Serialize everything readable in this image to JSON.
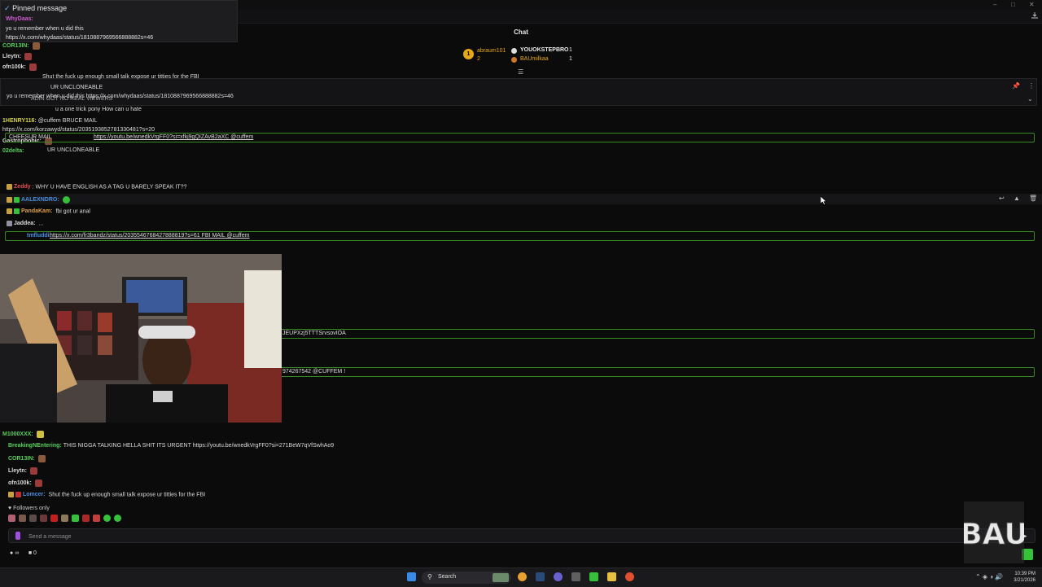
{
  "pinned": {
    "header": "Pinned message",
    "user": "WhyDaas:",
    "line1": "yo u remember when u did this",
    "line2": "https://x.com/whydaas/status/1810887969566888882s=46"
  },
  "chat_title": "Chat",
  "leaderboard": {
    "first_name": "abraum101",
    "first_count": "2",
    "second_name": "YOUOKSTEPBRO",
    "second_count": "1",
    "third_name": "BAUmilkaa",
    "third_count": "1"
  },
  "lines": [
    {
      "user": "COR13IN:",
      "text": "",
      "color": "#56d05a"
    },
    {
      "user": "Lleytn:",
      "text": "",
      "color": "#dcdcdc"
    },
    {
      "user": "ofn100k:",
      "text": "",
      "color": "#dcdcdc"
    },
    {
      "user": "",
      "text": "Shut the fuck up enough small talk expose ur titties for the FBI",
      "color": "#dcdcdc"
    },
    {
      "user": "",
      "text": "UR UNCLONEABLE",
      "color": "#dcdcdc"
    },
    {
      "user": "",
      "text": "yo u remember when u did this https://x.com/whydaas/status/1810887969566888882s=46",
      "color": "#dcdcdc"
    },
    {
      "user": "",
      "text": "ADIN GOT NO REAL VIEWERS",
      "color": "#dcdcdc"
    },
    {
      "user": "",
      "text": "u a one trick pony How can u hate",
      "color": "#dcdcdc"
    },
    {
      "user": "1HENRY116:",
      "text": "@cuffem BRUCE MAIL",
      "color": "#d6d24a"
    },
    {
      "user": "",
      "text": "https://x.com/korzawyd/status/2035193852781330481?s=20",
      "color": "#dcdcdc"
    },
    {
      "user": "Gastrophobic:",
      "text": "",
      "color": "#dcdcdc"
    },
    {
      "user": "02delta:",
      "text": "",
      "color": "#56d05a"
    },
    {
      "user": "",
      "text": "UR UNCLONEABLE",
      "color": "#dcdcdc"
    },
    {
      "user": "Zeddy",
      "text": "WHY U HAVE ENGLISH AS A TAG U BARELY SPEAK IT??",
      "color": "#e05050"
    },
    {
      "user": "AALEXNDRO:",
      "text": "",
      "color": "#4a8fe0"
    },
    {
      "user": "PandaKam:",
      "text": "fbi got ur anal",
      "color": "#e0a04a"
    },
    {
      "user": "Jaddea:",
      "text": "...",
      "color": "#dcdcdc"
    },
    {
      "user": "M1000XXX:",
      "text": "",
      "color": "#56d05a"
    },
    {
      "user": "BreakingNEntering:",
      "text": "THIS NIGGA TALKING HELLA SHIT ITS URGENT https://youtu.be/wnedkVrgFF0?si=271BeW7qVfSwhAo9",
      "color": "#56d05a"
    },
    {
      "user": "COR13IN:",
      "text": "",
      "color": "#56d05a"
    },
    {
      "user": "Lleytn:",
      "text": "",
      "color": "#dcdcdc"
    },
    {
      "user": "ofn100k:",
      "text": "",
      "color": "#dcdcdc"
    },
    {
      "user": "Lomcer:",
      "text": "Shut the fuck up enough small talk expose ur titties for the FBI",
      "color": "#4a8fe0"
    }
  ],
  "highlights": [
    {
      "user": "CHEESUR MAIL",
      "text": "https://youtu.be/wnedkVrgFF0?si=xfkj9gQIZAvB2aXC @cuffem"
    },
    {
      "user": "tmfluddi:",
      "text": "https://x.com/fr3bandz/status/2035546768427888819?s=61 FBI MAIL @cuffem"
    },
    {
      "user": "",
      "text": "JEUPXzj5TTTSrvsovIOA"
    },
    {
      "user": "",
      "text": "974267542 @CUFFEM !"
    }
  ],
  "followers_only": "Followers only",
  "input_placeholder": "Send a message",
  "bottom_stats": {
    "infinity": "∞",
    "count": "0"
  },
  "taskbar": {
    "search": "Search",
    "time": "10:39 PM",
    "date": "3/21/2026"
  },
  "logo_text": "BAU",
  "colors": {
    "accent": "#3a8a24",
    "gold": "#e6a817",
    "green_badge": "#35c23a"
  }
}
